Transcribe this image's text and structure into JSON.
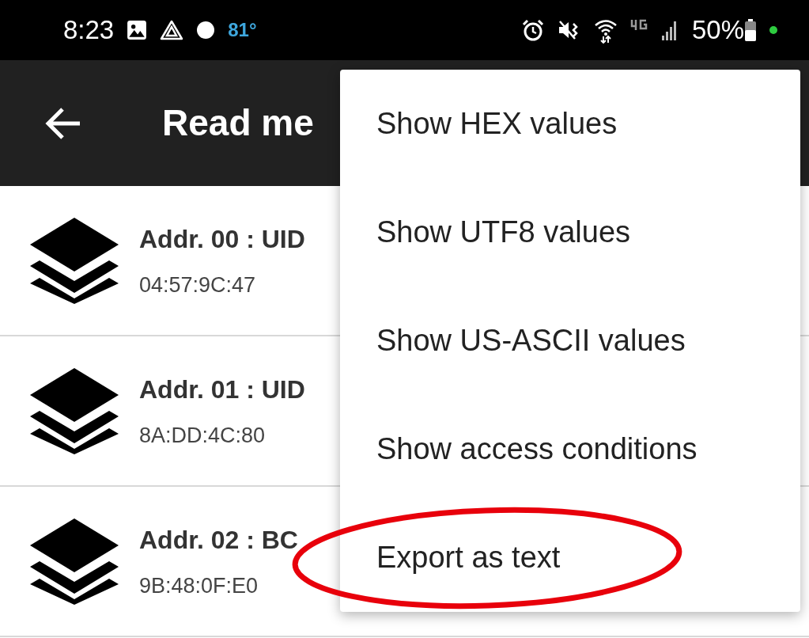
{
  "status_bar": {
    "time": "8:23",
    "temperature": "81°",
    "battery": "50%"
  },
  "app_bar": {
    "title": "Read me"
  },
  "blocks": [
    {
      "title": "Addr. 00 : UID",
      "value": "04:57:9C:47"
    },
    {
      "title": "Addr. 01 : UID",
      "value": "8A:DD:4C:80"
    },
    {
      "title": "Addr. 02 : BC",
      "value": "9B:48:0F:E0"
    }
  ],
  "menu": [
    {
      "label": "Show HEX values",
      "circled": false
    },
    {
      "label": "Show UTF8 values",
      "circled": false
    },
    {
      "label": "Show US-ASCII values",
      "circled": false
    },
    {
      "label": "Show access conditions",
      "circled": false
    },
    {
      "label": "Export as text",
      "circled": true
    }
  ]
}
